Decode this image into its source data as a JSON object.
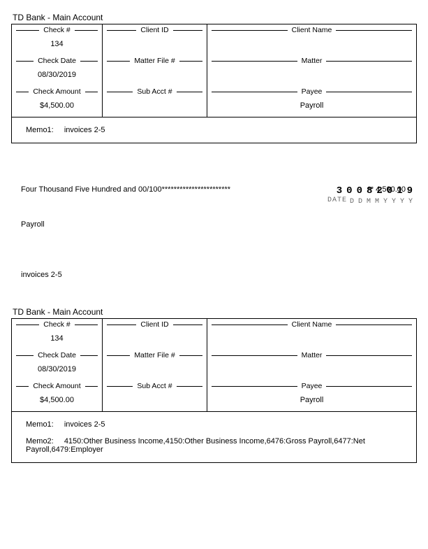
{
  "account_title": "TD Bank - Main Account",
  "stub1": {
    "check_no": {
      "label": "Check #",
      "value": "134"
    },
    "client_id": {
      "label": "Client ID",
      "value": ""
    },
    "client_name": {
      "label": "Client Name",
      "value": ""
    },
    "check_date": {
      "label": "Check Date",
      "value": "08/30/2019"
    },
    "matter_file": {
      "label": "Matter File #",
      "value": ""
    },
    "matter": {
      "label": "Matter",
      "value": ""
    },
    "check_amount": {
      "label": "Check Amount",
      "value": "$4,500.00"
    },
    "sub_acct": {
      "label": "Sub Acct #",
      "value": ""
    },
    "payee": {
      "label": "Payee",
      "value": "Payroll"
    },
    "memo1": {
      "label": "Memo1:",
      "value": "invoices 2-5"
    }
  },
  "check": {
    "date_digits": "30082019",
    "date_word": "DATE",
    "date_pattern": "DDMMYYYY",
    "amount_words": "Four Thousand Five Hundred and 00/100***********************",
    "amount_numeric": "** 4,500.00",
    "payee": "Payroll",
    "memo": "invoices 2-5"
  },
  "stub2": {
    "check_no": {
      "label": "Check #",
      "value": "134"
    },
    "client_id": {
      "label": "Client ID",
      "value": ""
    },
    "client_name": {
      "label": "Client Name",
      "value": ""
    },
    "check_date": {
      "label": "Check Date",
      "value": "08/30/2019"
    },
    "matter_file": {
      "label": "Matter File #",
      "value": ""
    },
    "matter": {
      "label": "Matter",
      "value": ""
    },
    "check_amount": {
      "label": "Check Amount",
      "value": "$4,500.00"
    },
    "sub_acct": {
      "label": "Sub Acct #",
      "value": ""
    },
    "payee": {
      "label": "Payee",
      "value": "Payroll"
    },
    "memo1": {
      "label": "Memo1:",
      "value": "invoices 2-5"
    },
    "memo2": {
      "label": "Memo2:",
      "value": "4150:Other Business Income,4150:Other Business Income,6476:Gross Payroll,6477:Net Payroll,6479:Employer"
    }
  }
}
